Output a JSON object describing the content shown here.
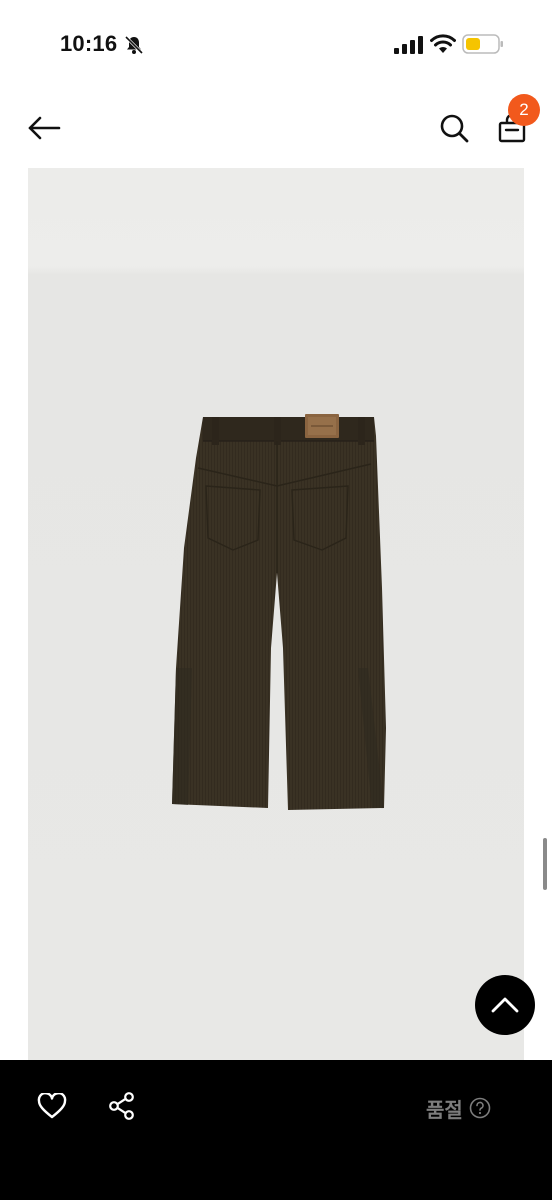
{
  "status_bar": {
    "time": "10:16",
    "icons": [
      "bell-off-icon",
      "signal-icon",
      "wifi-icon",
      "battery-icon"
    ],
    "battery_color": "#f5c400"
  },
  "header": {
    "icons": [
      "back-arrow-icon",
      "search-icon",
      "shopping-bag-icon"
    ],
    "cart_count": "2",
    "badge_color": "#f2591c"
  },
  "product": {
    "image_icon": "corduroy-pants-photo",
    "pants_color": "#3a3224",
    "background_color": "#e8e8e6"
  },
  "floating": {
    "scroll_top_icon": "chevron-up-icon"
  },
  "bottom_bar": {
    "icons": [
      "heart-icon",
      "share-icon",
      "help-circle-icon"
    ],
    "status_label": "품절",
    "status_color": "#7d7d7d"
  }
}
